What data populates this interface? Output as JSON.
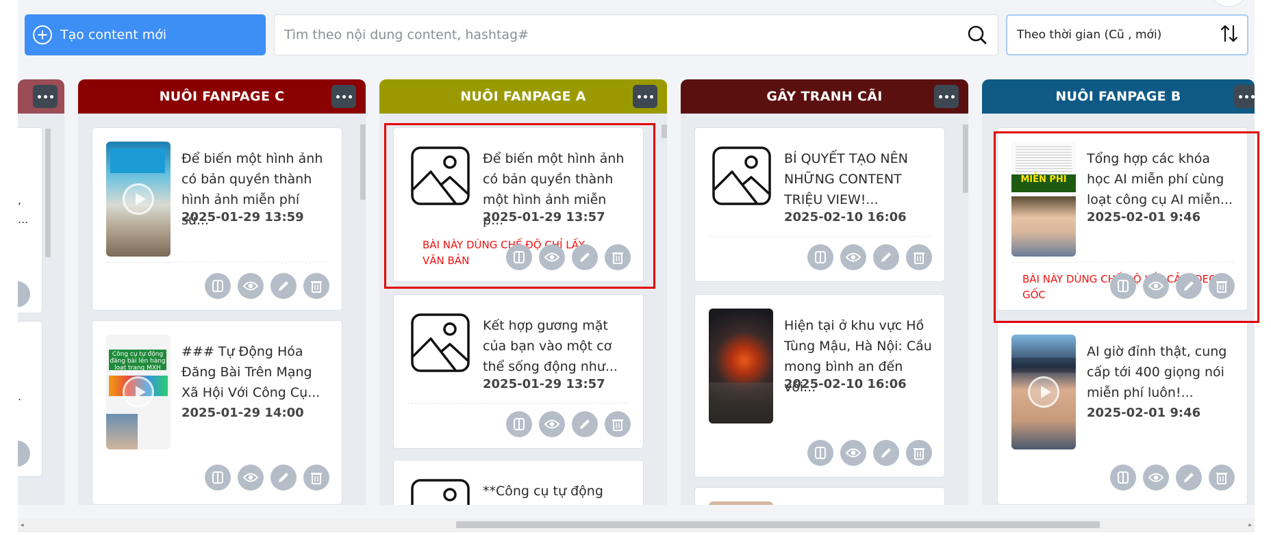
{
  "toolbar": {
    "create_label": "Tạo content mới",
    "search_placeholder": "Tìm theo nội dung content, hashtag#",
    "sort_label": "Theo thời gian (Cũ , mới)"
  },
  "colors": {
    "primary": "#3d8ef5",
    "col_c": "#8b0000",
    "col_a": "#9a9a00",
    "col_gay": "#5b1010",
    "col_b": "#0f5a85",
    "col_partial": "#9b4c55",
    "annotation": "#e00000"
  },
  "columns": [
    {
      "title": "NUÔI FANPAGE C",
      "cards": [
        {
          "text": "Để biến một hình ảnh có bản quyền thành hình ảnh miễn phí sử...",
          "date": "2025-01-29 13:59"
        },
        {
          "text": "### Tự Động Hóa Đăng Bài Trên Mạng Xã Hội Với Công Cụ...",
          "date": "2025-01-29 14:00",
          "thumb_caption": "Công cụ tự động đăng bài lên hàng loạt trang MXH"
        }
      ]
    },
    {
      "title": "NUÔI FANPAGE A",
      "cards": [
        {
          "text": "Để biến một hình ảnh có bản quyền thành một hình ảnh miễn p...",
          "date": "2025-01-29 13:57",
          "annotation": "BÀI NÀY DÙNG CHẾ ĐỘ CHỈ LẤY VĂN BẢN"
        },
        {
          "text": "Kết hợp gương mặt của bạn vào một cơ thể sống động như...",
          "date": "2025-01-29 13:57"
        },
        {
          "text": "**Công cụ tự động hóa"
        }
      ]
    },
    {
      "title": "GÂY TRANH CÃI",
      "cards": [
        {
          "text": "BÍ QUYẾT TẠO NÊN NHỮNG CONTENT TRIỆU VIEW!...",
          "date": "2025-02-10 16:06"
        },
        {
          "text": "Hiện tại ở khu vực Hồ Tùng Mậu, Hà Nội: Cầu mong bình an đến với...",
          "date": "2025-02-10 16:06"
        }
      ]
    },
    {
      "title": "NUÔI FANPAGE B",
      "cards": [
        {
          "text": "Tổng hợp các khóa học AI miễn phí cùng loạt công cụ AI miễn...",
          "date": "2025-02-01 9:46",
          "annotation": "BÀI NÀY DÙNG CHẾ ĐỘ LẤY CẢ VIDEO GỐC",
          "thumb_caption": "MIỄN PHÍ"
        },
        {
          "text": "AI giờ đỉnh thật, cung cấp tới 400 giọng nói miễn phí luôn!...",
          "date": "2025-02-01 9:46"
        }
      ]
    }
  ],
  "partial_column": {
    "text_fragments": [
      ",",
      "...",
      "."
    ]
  }
}
